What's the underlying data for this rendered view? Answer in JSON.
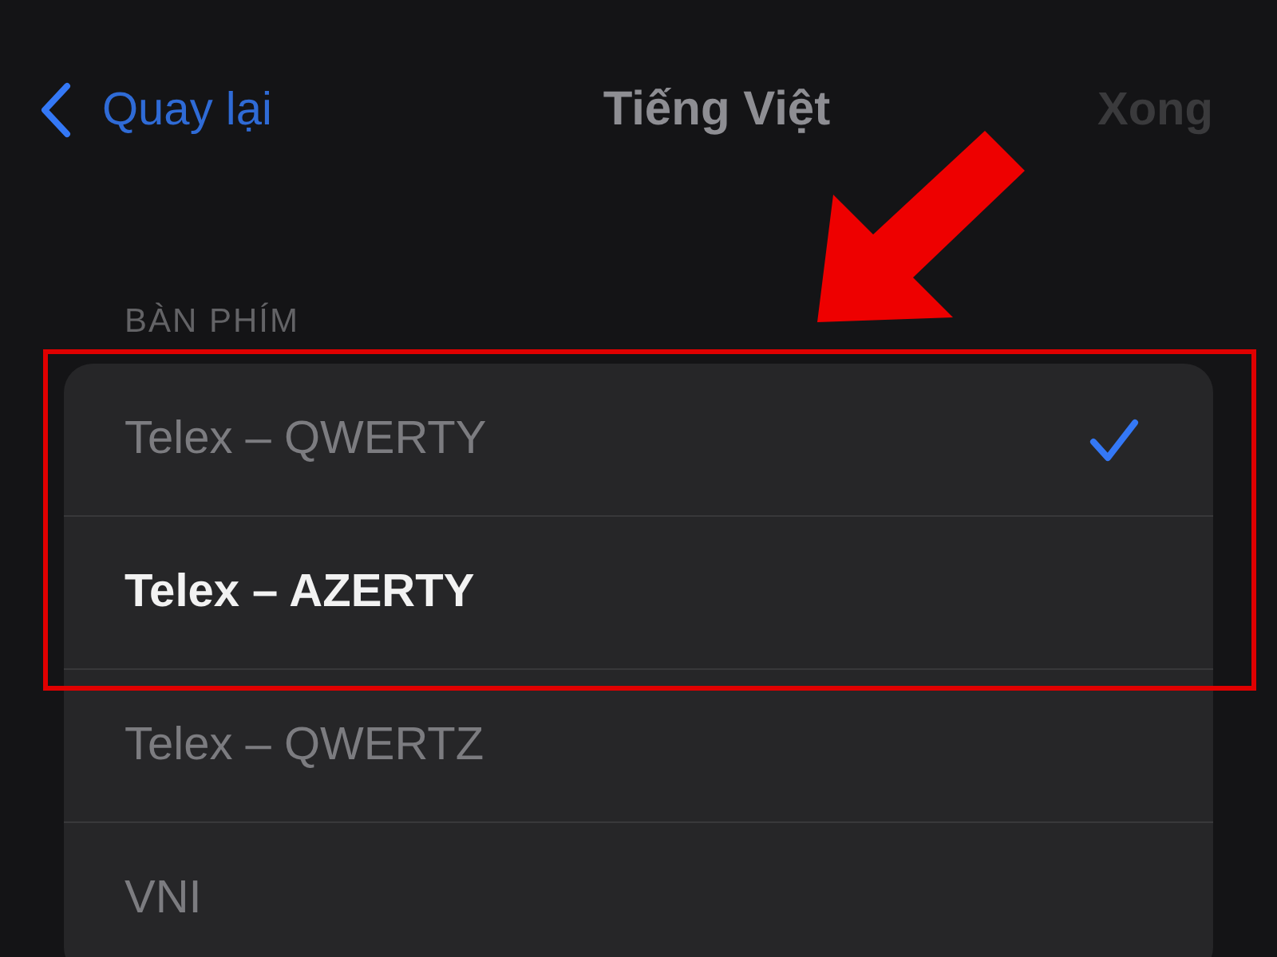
{
  "nav": {
    "back_label": "Quay lại",
    "title": "Tiếng Việt",
    "done_label": "Xong",
    "done_disabled": true
  },
  "section": {
    "header": "BÀN PHÍM",
    "items": [
      {
        "label": "Telex – QWERTY",
        "selected": true,
        "highlighted": false
      },
      {
        "label": "Telex – AZERTY",
        "selected": false,
        "highlighted": true
      },
      {
        "label": "Telex – QWERTZ",
        "selected": false,
        "highlighted": false
      },
      {
        "label": "VNI",
        "selected": false,
        "highlighted": false
      }
    ]
  },
  "annotation": {
    "highlight_frame": true,
    "arrow": true
  }
}
